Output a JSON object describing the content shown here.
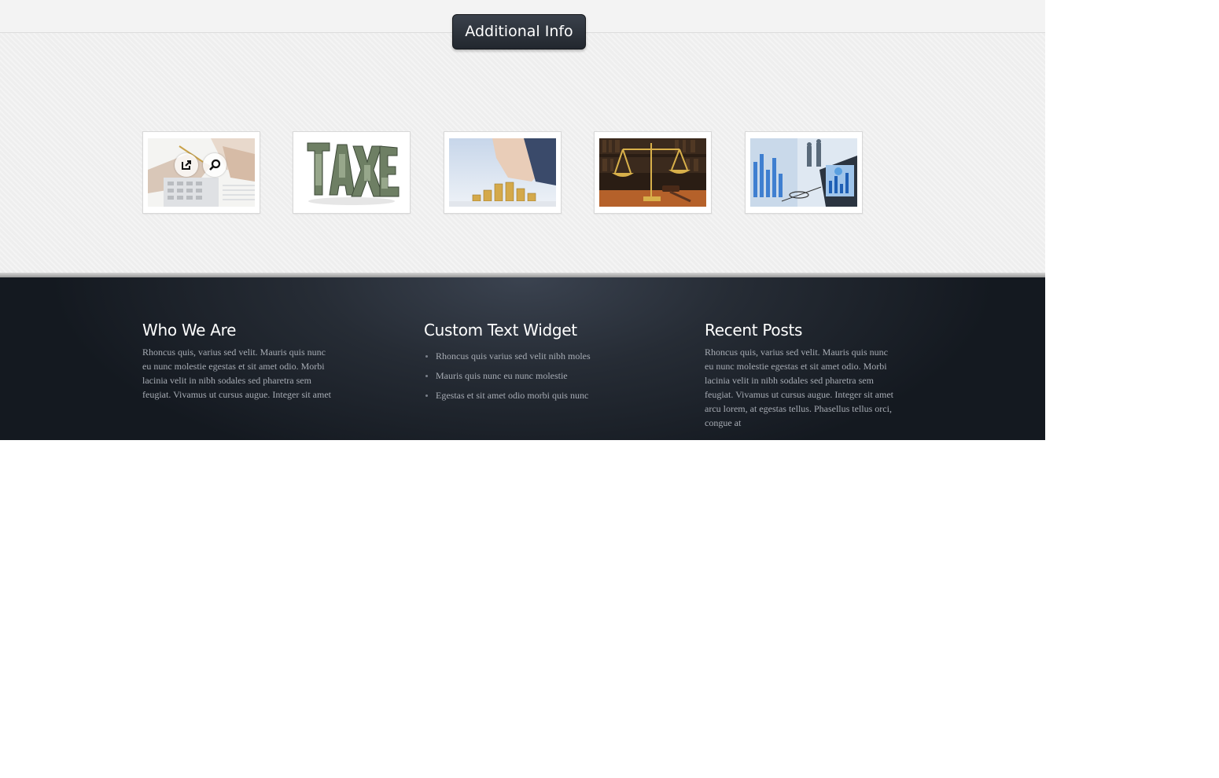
{
  "section_tab": {
    "label": "Additional Info"
  },
  "gallery": {
    "items": [
      {
        "icon": "calculator-hands-photo",
        "actions": [
          "external-link-icon",
          "zoom-icon"
        ]
      },
      {
        "icon": "taxes-money-photo"
      },
      {
        "icon": "coins-stack-photo"
      },
      {
        "icon": "justice-scale-photo"
      },
      {
        "icon": "business-charts-photo"
      }
    ]
  },
  "footer": {
    "who_we_are": {
      "title": "Who We Are",
      "text": "Rhoncus quis, varius sed velit. Mauris quis nunc eu nunc molestie egestas et sit amet odio. Morbi lacinia velit in nibh sodales sed pharetra sem feugiat. Vivamus ut cursus augue. Integer sit amet"
    },
    "custom_text_widget": {
      "title": "Custom Text Widget",
      "items": [
        "Rhoncus quis varius sed velit nibh moles",
        "Mauris quis nunc eu nunc molestie",
        "Egestas et sit amet odio morbi quis nunc"
      ]
    },
    "recent_posts": {
      "title": "Recent Posts",
      "text": "Rhoncus quis, varius sed velit. Mauris quis nunc eu nunc molestie egestas et sit amet odio. Morbi lacinia velit in nibh sodales sed pharetra sem feugiat. Vivamus ut cursus augue. Integer sit amet arcu lorem, at egestas tellus. Phasellus tellus orci, congue at"
    }
  },
  "colors": {
    "tab_bg": "#2b3139",
    "footer_bg": "#1b2029",
    "footer_heading": "#ffffff",
    "footer_text": "#a7acb4"
  }
}
